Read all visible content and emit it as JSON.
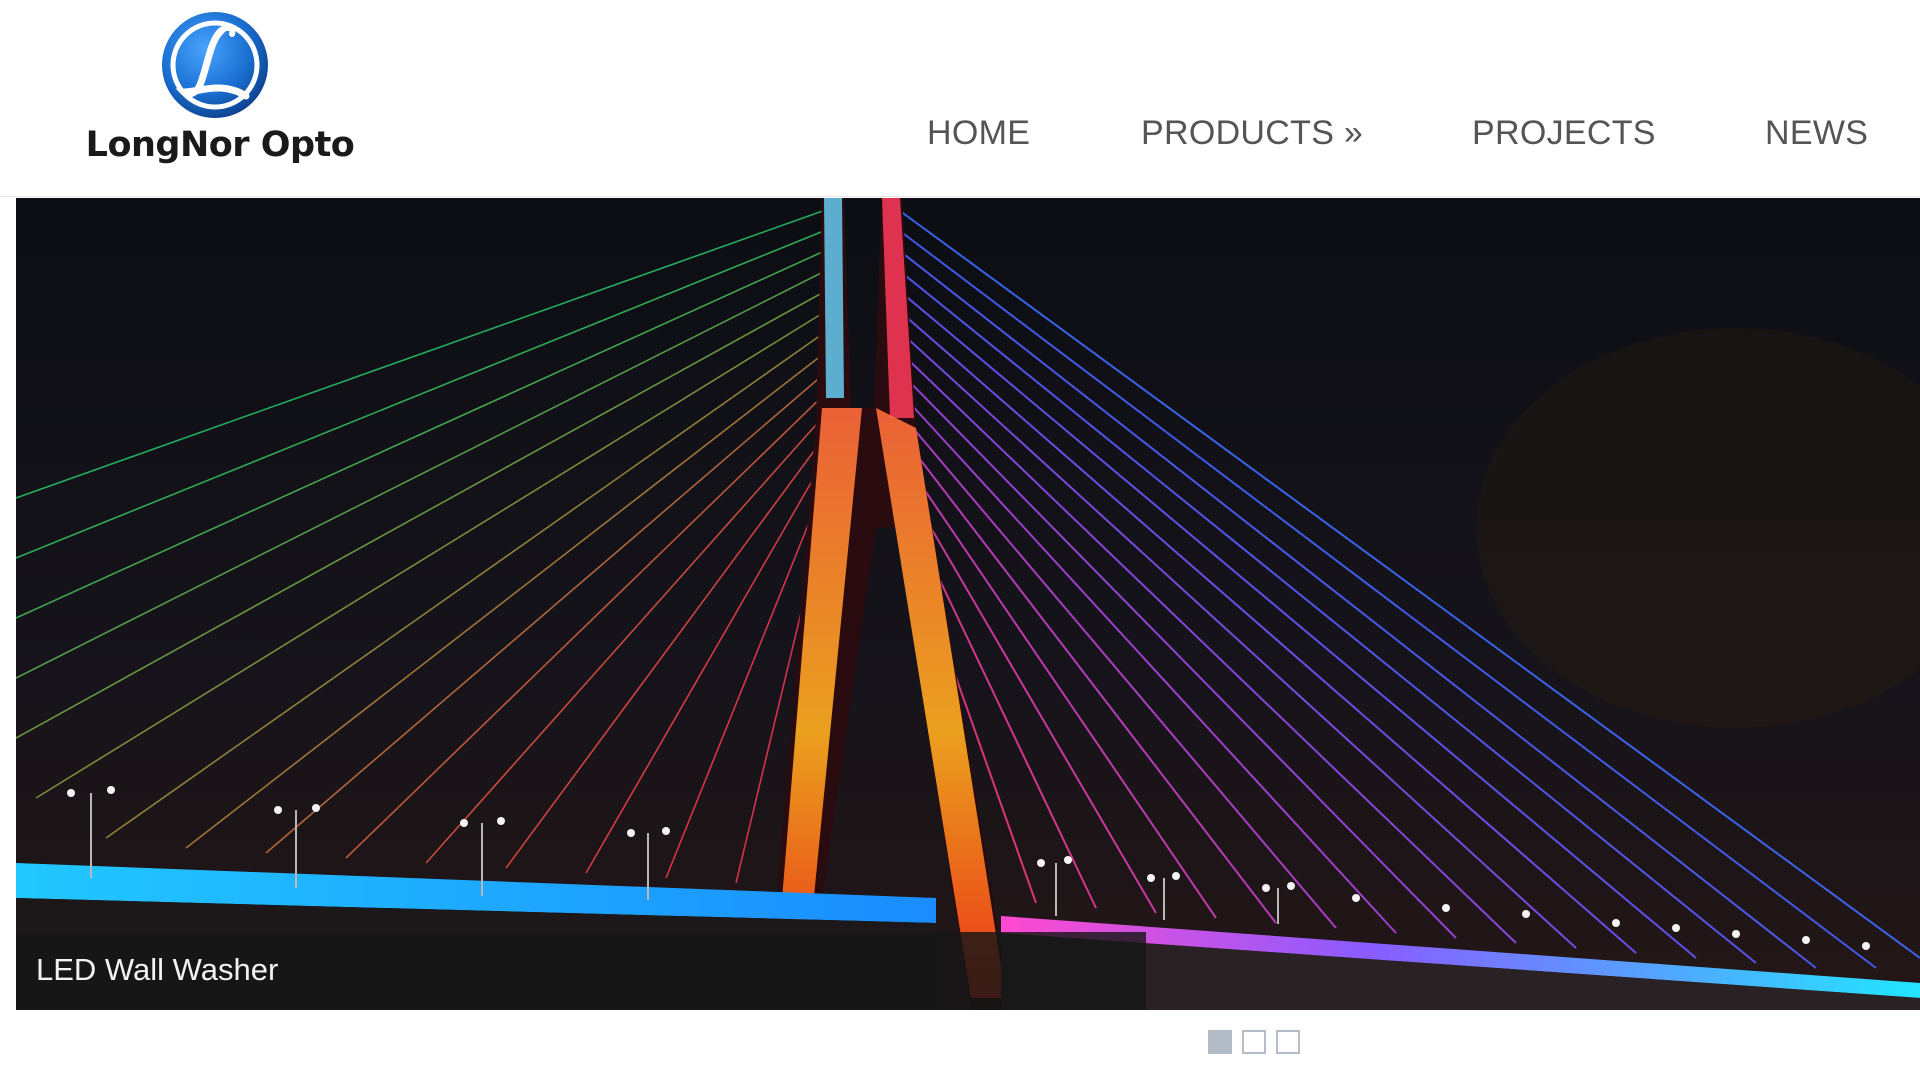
{
  "brand": {
    "name": "LongNor Opto",
    "logo_icon": "longnor-l-logo-icon",
    "logo_color": "#1a6fd1"
  },
  "nav": {
    "items": [
      {
        "label": "HOME"
      },
      {
        "label": "PRODUCTS »"
      },
      {
        "label": "PROJECTS"
      },
      {
        "label": "NEWS"
      }
    ]
  },
  "slider": {
    "caption": "LED Wall Washer",
    "slide_count": 3,
    "active_slide": 1
  },
  "colors": {
    "nav_text": "#555555",
    "pager_active": "#b3bcc7"
  }
}
